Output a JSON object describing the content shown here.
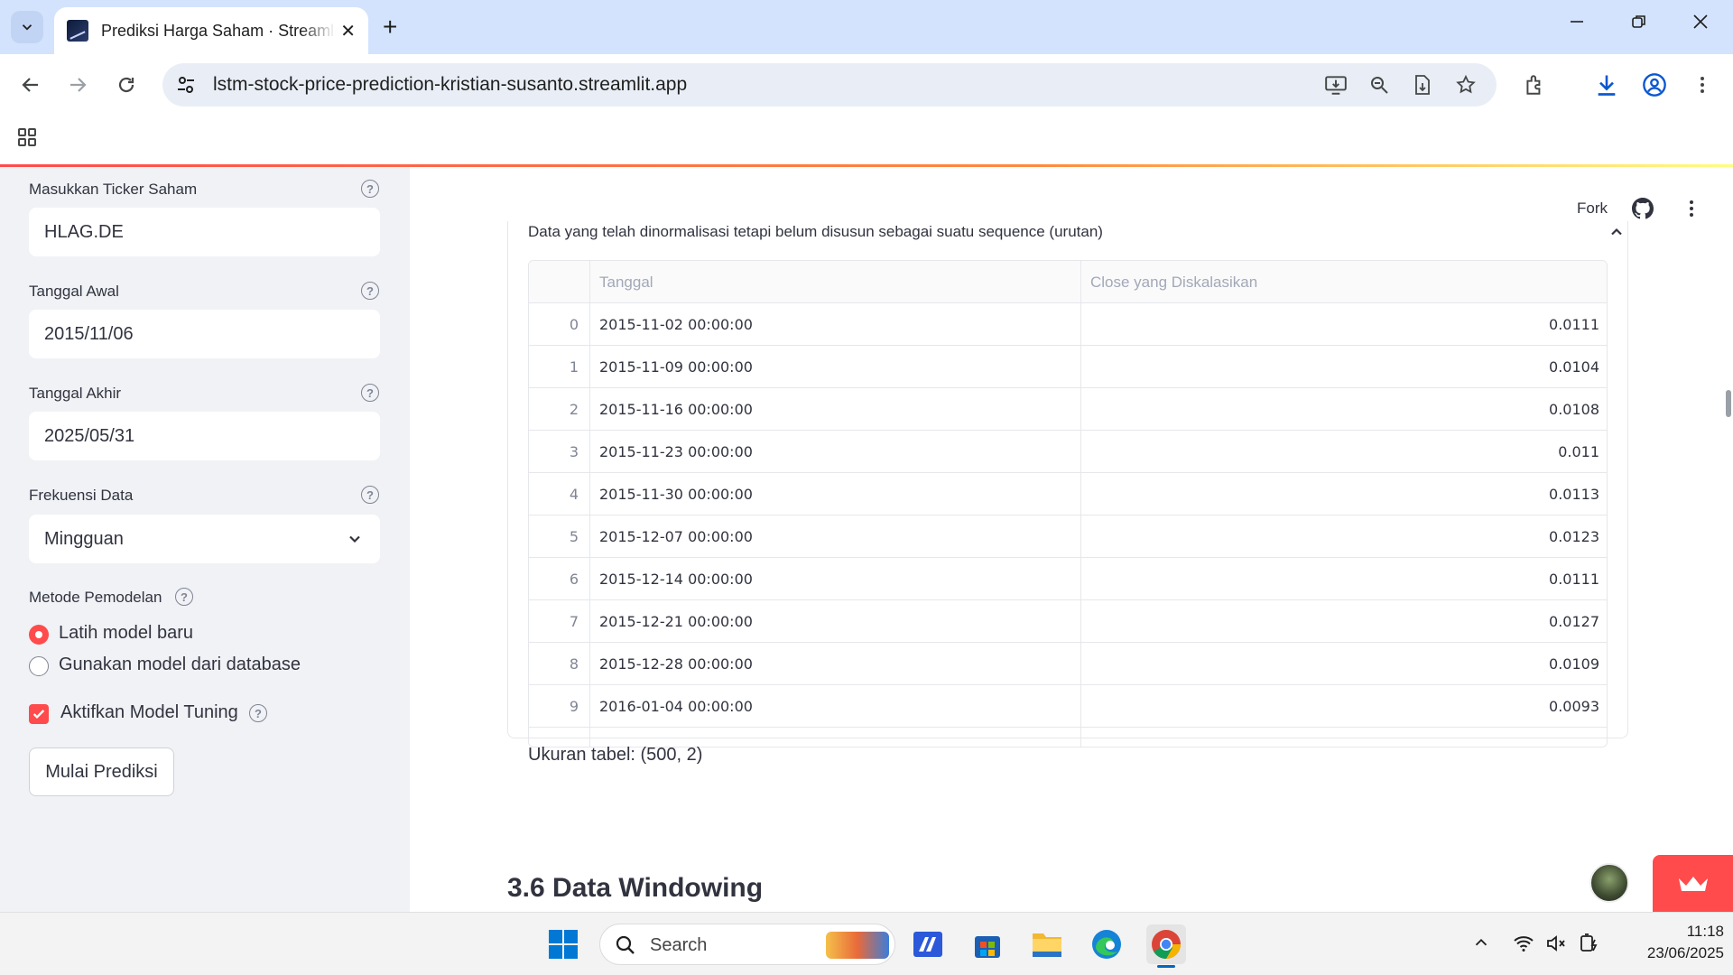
{
  "browser": {
    "tab_title": "Prediksi Harga Saham · Streamlit",
    "url": "lstm-stock-price-prediction-kristian-susanto.streamlit.app"
  },
  "sidebar": {
    "ticker_label": "Masukkan Ticker Saham",
    "ticker_value": "HLAG.DE",
    "start_label": "Tanggal Awal",
    "start_value": "2015/11/06",
    "end_label": "Tanggal Akhir",
    "end_value": "2025/05/31",
    "freq_label": "Frekuensi Data",
    "freq_value": "Mingguan",
    "method_label": "Metode Pemodelan",
    "method_options": [
      "Latih model baru",
      "Gunakan model dari database"
    ],
    "tuning_label": "Aktifkan Model Tuning",
    "predict_button": "Mulai Prediksi"
  },
  "header": {
    "fork_label": "Fork"
  },
  "main": {
    "expander_title": "Data yang telah dinormalisasi tetapi belum disusun sebagai suatu sequence (urutan)",
    "table": {
      "columns": [
        "Tanggal",
        "Close yang Diskalasikan"
      ],
      "rows": [
        {
          "idx": "0",
          "date": "2015-11-02 00:00:00",
          "val": "0.0111"
        },
        {
          "idx": "1",
          "date": "2015-11-09 00:00:00",
          "val": "0.0104"
        },
        {
          "idx": "2",
          "date": "2015-11-16 00:00:00",
          "val": "0.0108"
        },
        {
          "idx": "3",
          "date": "2015-11-23 00:00:00",
          "val": "0.011"
        },
        {
          "idx": "4",
          "date": "2015-11-30 00:00:00",
          "val": "0.0113"
        },
        {
          "idx": "5",
          "date": "2015-12-07 00:00:00",
          "val": "0.0123"
        },
        {
          "idx": "6",
          "date": "2015-12-14 00:00:00",
          "val": "0.0111"
        },
        {
          "idx": "7",
          "date": "2015-12-21 00:00:00",
          "val": "0.0127"
        },
        {
          "idx": "8",
          "date": "2015-12-28 00:00:00",
          "val": "0.0109"
        },
        {
          "idx": "9",
          "date": "2016-01-04 00:00:00",
          "val": "0.0093"
        }
      ]
    },
    "table_size": "Ukuran tabel: (500, 2)",
    "section_heading": "3.6 Data Windowing"
  },
  "taskbar": {
    "search_placeholder": "Search",
    "time": "11:18",
    "date": "23/06/2025"
  },
  "colors": {
    "accent": "#ff4b4b",
    "sidebar_bg": "#f0f2f6",
    "tabbar_bg": "#d3e3fd"
  }
}
